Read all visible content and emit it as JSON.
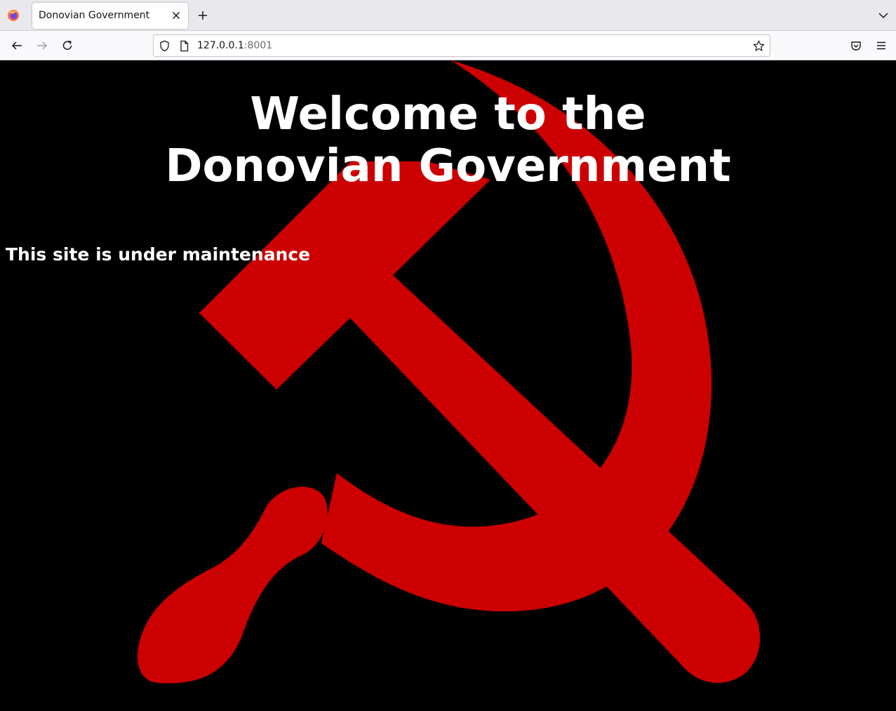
{
  "browser": {
    "tab": {
      "title": "Donovian Government"
    },
    "url": {
      "host": "127.0.0.1",
      "port": ":8001"
    }
  },
  "page": {
    "headline": "Welcome to the Donovian Government",
    "notice": "This site is under maintenance",
    "emblem_color": "#cc0000",
    "background_color": "#000000"
  }
}
